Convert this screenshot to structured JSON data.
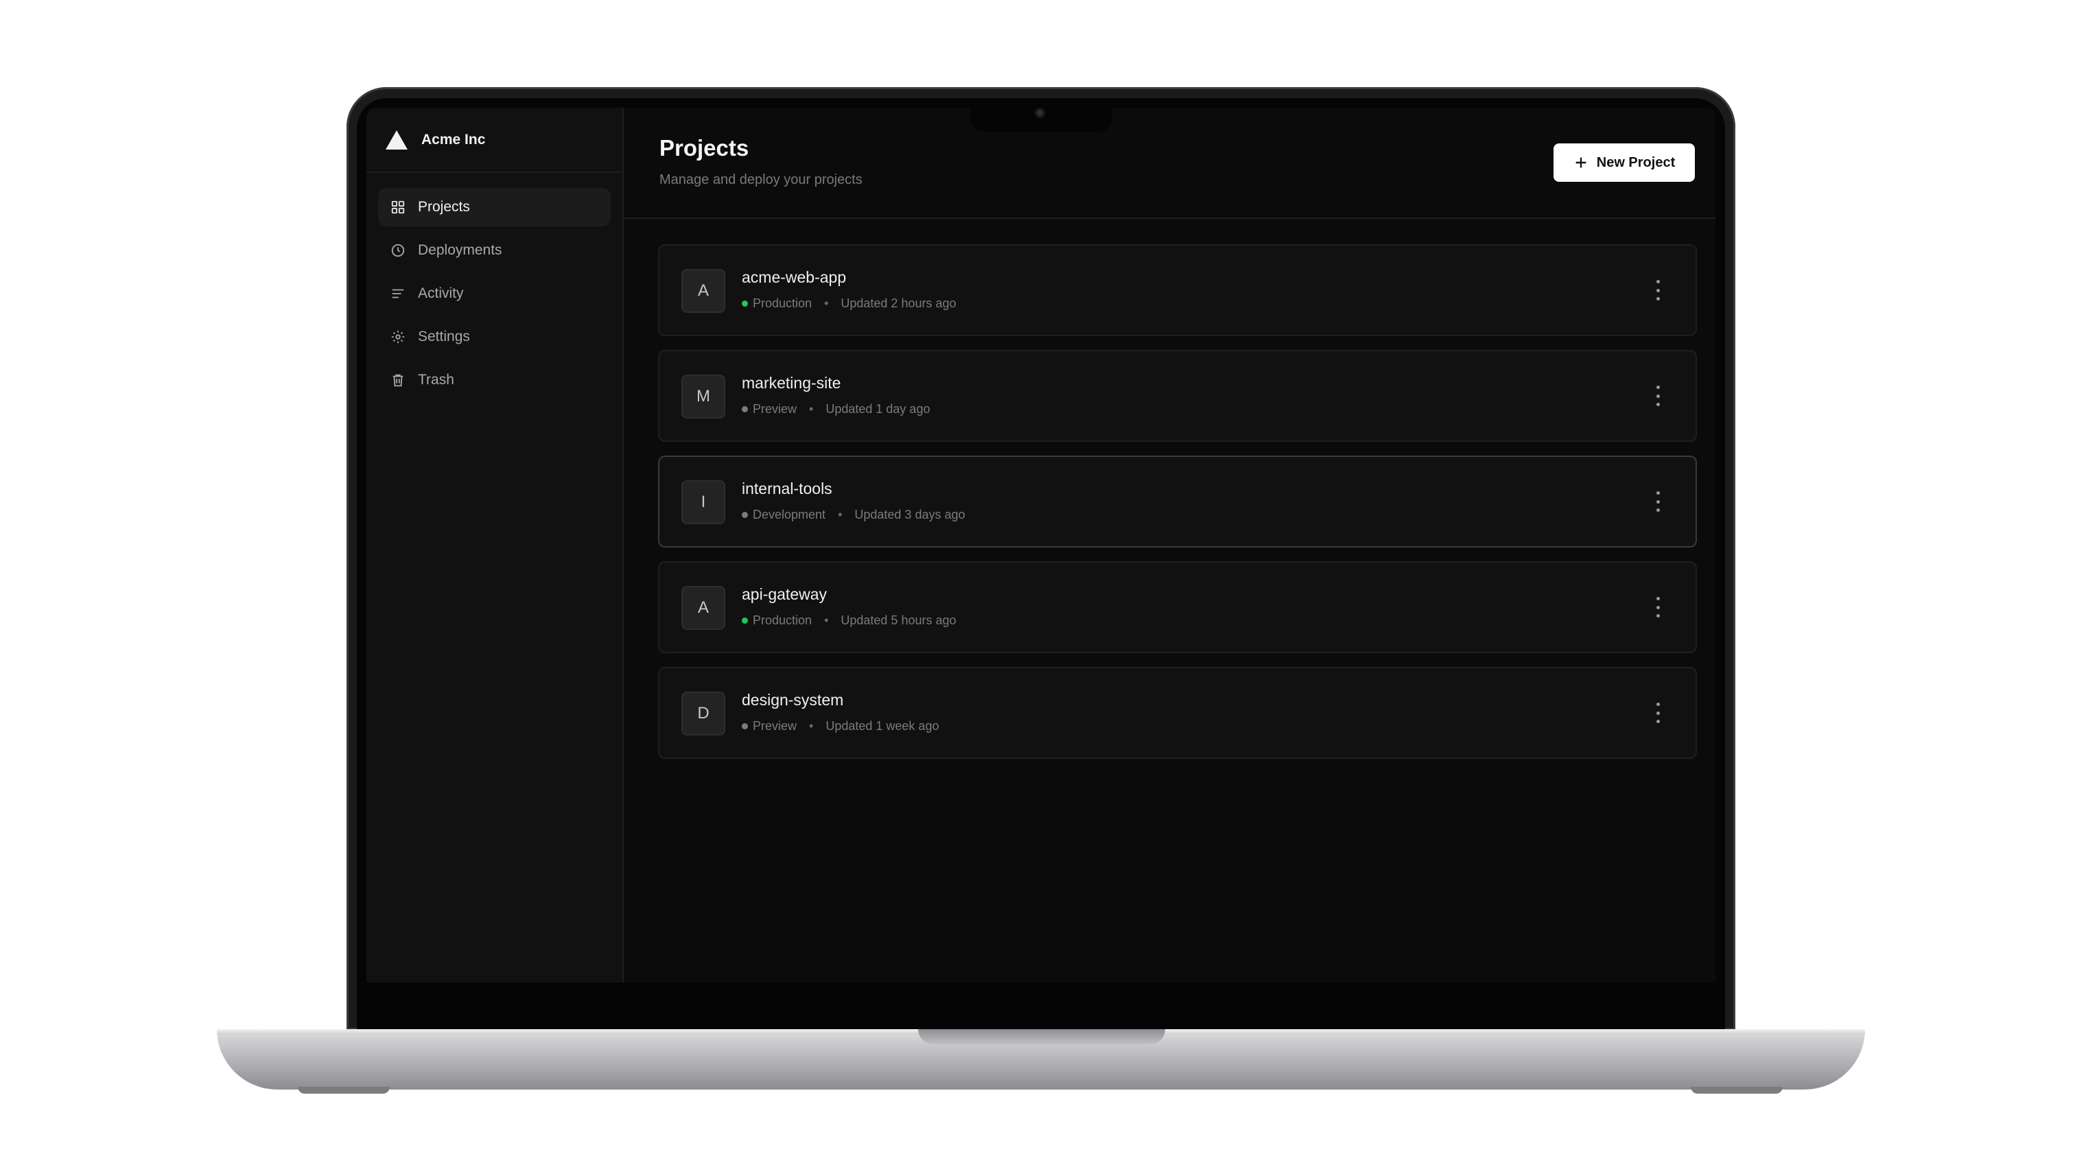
{
  "colors": {
    "background": "#0b0b0b",
    "sidebar": "#111111",
    "card": "#111111",
    "status_production": "#22c55e",
    "status_other": "#7b7b7b",
    "button_bg": "#ffffff"
  },
  "sidebar": {
    "brand": {
      "name": "Acme Inc",
      "icon": "triangle-logo-icon"
    },
    "items": [
      {
        "label": "Projects",
        "icon": "grid-icon",
        "active": true
      },
      {
        "label": "Deployments",
        "icon": "clock-icon",
        "active": false
      },
      {
        "label": "Activity",
        "icon": "list-icon",
        "active": false
      },
      {
        "label": "Settings",
        "icon": "gear-icon",
        "active": false
      },
      {
        "label": "Trash",
        "icon": "trash-icon",
        "active": false
      }
    ]
  },
  "header": {
    "title": "Projects",
    "subtitle": "Manage and deploy your projects",
    "new_button": {
      "label": "New Project",
      "icon": "plus-icon"
    }
  },
  "projects": [
    {
      "initial": "A",
      "name": "acme-web-app",
      "status": "Production",
      "updated": "Updated 2 hours ago"
    },
    {
      "initial": "M",
      "name": "marketing-site",
      "status": "Preview",
      "updated": "Updated 1 day ago"
    },
    {
      "initial": "I",
      "name": "internal-tools",
      "status": "Development",
      "updated": "Updated 3 days ago",
      "highlighted": true
    },
    {
      "initial": "A",
      "name": "api-gateway",
      "status": "Production",
      "updated": "Updated 5 hours ago"
    },
    {
      "initial": "D",
      "name": "design-system",
      "status": "Preview",
      "updated": "Updated 1 week ago"
    }
  ]
}
